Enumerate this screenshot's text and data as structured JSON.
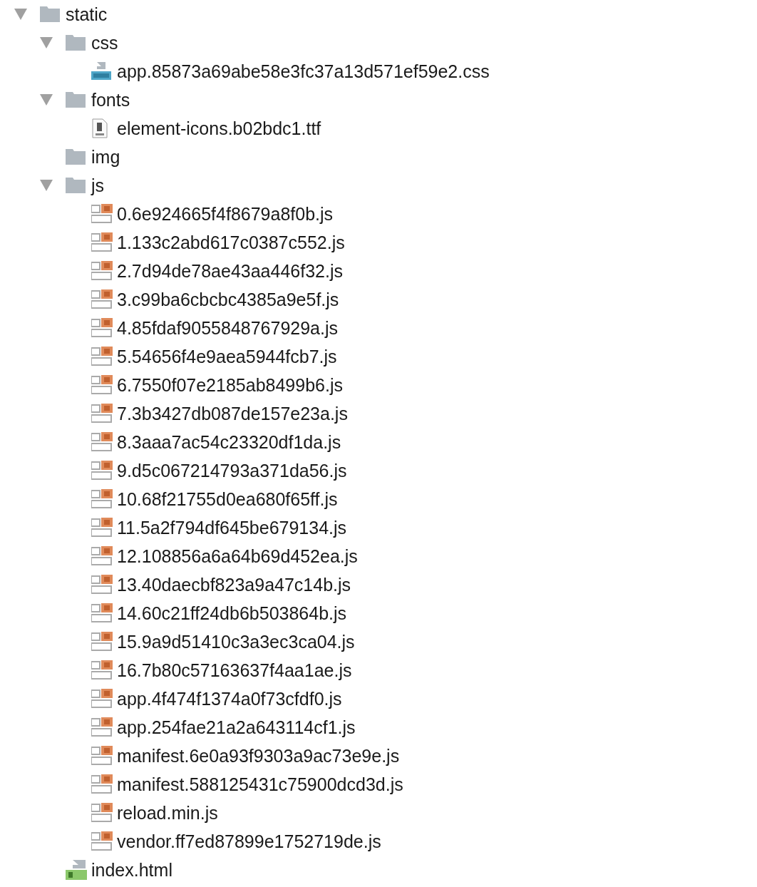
{
  "tree": [
    {
      "name": "static",
      "kind": "folder",
      "expanded": true,
      "children": [
        {
          "name": "css",
          "kind": "folder",
          "expanded": true,
          "children": [
            {
              "name": "app.85873a69abe58e3fc37a13d571ef59e2.css",
              "kind": "css"
            }
          ]
        },
        {
          "name": "fonts",
          "kind": "folder",
          "expanded": true,
          "children": [
            {
              "name": "element-icons.b02bdc1.ttf",
              "kind": "font"
            }
          ]
        },
        {
          "name": "img",
          "kind": "folder"
        },
        {
          "name": "js",
          "kind": "folder",
          "expanded": true,
          "children": [
            {
              "name": "0.6e924665f4f8679a8f0b.js",
              "kind": "js"
            },
            {
              "name": "1.133c2abd617c0387c552.js",
              "kind": "js"
            },
            {
              "name": "2.7d94de78ae43aa446f32.js",
              "kind": "js"
            },
            {
              "name": "3.c99ba6cbcbc4385a9e5f.js",
              "kind": "js"
            },
            {
              "name": "4.85fdaf9055848767929a.js",
              "kind": "js"
            },
            {
              "name": "5.54656f4e9aea5944fcb7.js",
              "kind": "js"
            },
            {
              "name": "6.7550f07e2185ab8499b6.js",
              "kind": "js"
            },
            {
              "name": "7.3b3427db087de157e23a.js",
              "kind": "js"
            },
            {
              "name": "8.3aaa7ac54c23320df1da.js",
              "kind": "js"
            },
            {
              "name": "9.d5c067214793a371da56.js",
              "kind": "js"
            },
            {
              "name": "10.68f21755d0ea680f65ff.js",
              "kind": "js"
            },
            {
              "name": "11.5a2f794df645be679134.js",
              "kind": "js"
            },
            {
              "name": "12.108856a6a64b69d452ea.js",
              "kind": "js"
            },
            {
              "name": "13.40daecbf823a9a47c14b.js",
              "kind": "js"
            },
            {
              "name": "14.60c21ff24db6b503864b.js",
              "kind": "js"
            },
            {
              "name": "15.9a9d51410c3a3ec3ca04.js",
              "kind": "js"
            },
            {
              "name": "16.7b80c57163637f4aa1ae.js",
              "kind": "js"
            },
            {
              "name": "app.4f474f1374a0f73cfdf0.js",
              "kind": "js"
            },
            {
              "name": "app.254fae21a2a643114cf1.js",
              "kind": "js"
            },
            {
              "name": "manifest.6e0a93f9303a9ac73e9e.js",
              "kind": "js"
            },
            {
              "name": "manifest.588125431c75900dcd3d.js",
              "kind": "js"
            },
            {
              "name": "reload.min.js",
              "kind": "js"
            },
            {
              "name": "vendor.ff7ed87899e1752719de.js",
              "kind": "js"
            }
          ]
        },
        {
          "name": "index.html",
          "kind": "html"
        }
      ]
    }
  ]
}
